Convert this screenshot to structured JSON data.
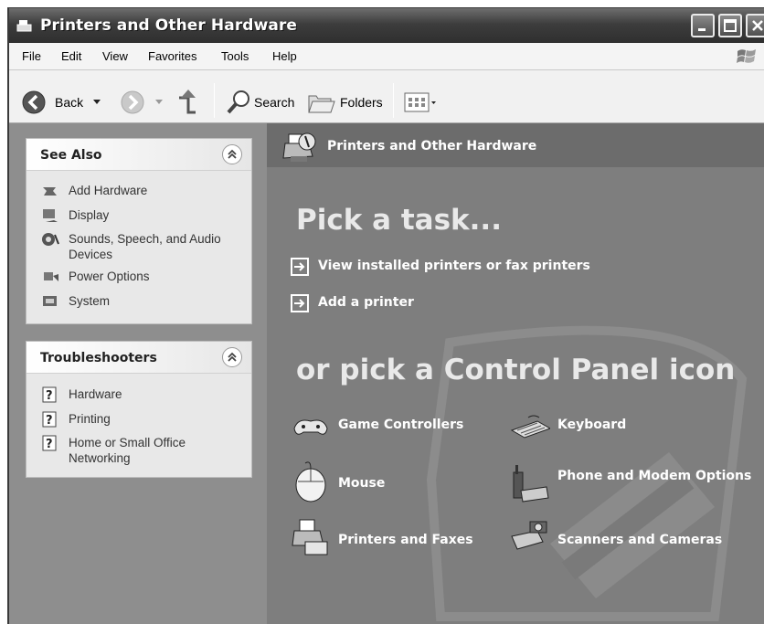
{
  "window": {
    "title": "Printers and Other Hardware"
  },
  "menu": [
    "File",
    "Edit",
    "View",
    "Favorites",
    "Tools",
    "Help"
  ],
  "toolbar": {
    "back": "Back",
    "search": "Search",
    "folders": "Folders"
  },
  "header": {
    "title": "Printers and Other Hardware"
  },
  "see_also": {
    "title": "See Also",
    "items": [
      {
        "label": "Add Hardware",
        "icon": "add-hardware-icon"
      },
      {
        "label": "Display",
        "icon": "display-icon"
      },
      {
        "label": "Sounds, Speech, and Audio Devices",
        "icon": "sounds-icon"
      },
      {
        "label": "Power Options",
        "icon": "power-options-icon"
      },
      {
        "label": "System",
        "icon": "system-icon"
      }
    ]
  },
  "troubleshooters": {
    "title": "Troubleshooters",
    "items": [
      {
        "label": "Hardware",
        "icon": "help-icon"
      },
      {
        "label": "Printing",
        "icon": "help-icon"
      },
      {
        "label": "Home or Small Office Networking",
        "icon": "help-icon"
      }
    ]
  },
  "pick_task": "Pick a task...",
  "tasks": [
    "View installed printers or fax printers",
    "Add a printer"
  ],
  "pick_icon": "or pick a Control Panel icon",
  "icons": [
    {
      "label": "Game Controllers",
      "icon": "game-controller-icon"
    },
    {
      "label": "Keyboard",
      "icon": "keyboard-icon"
    },
    {
      "label": "Mouse",
      "icon": "mouse-icon"
    },
    {
      "label": "Phone and Modem Options",
      "icon": "phone-modem-icon"
    },
    {
      "label": "Printers and Faxes",
      "icon": "printers-faxes-icon"
    },
    {
      "label": "Scanners and Cameras",
      "icon": "scanner-camera-icon"
    }
  ]
}
